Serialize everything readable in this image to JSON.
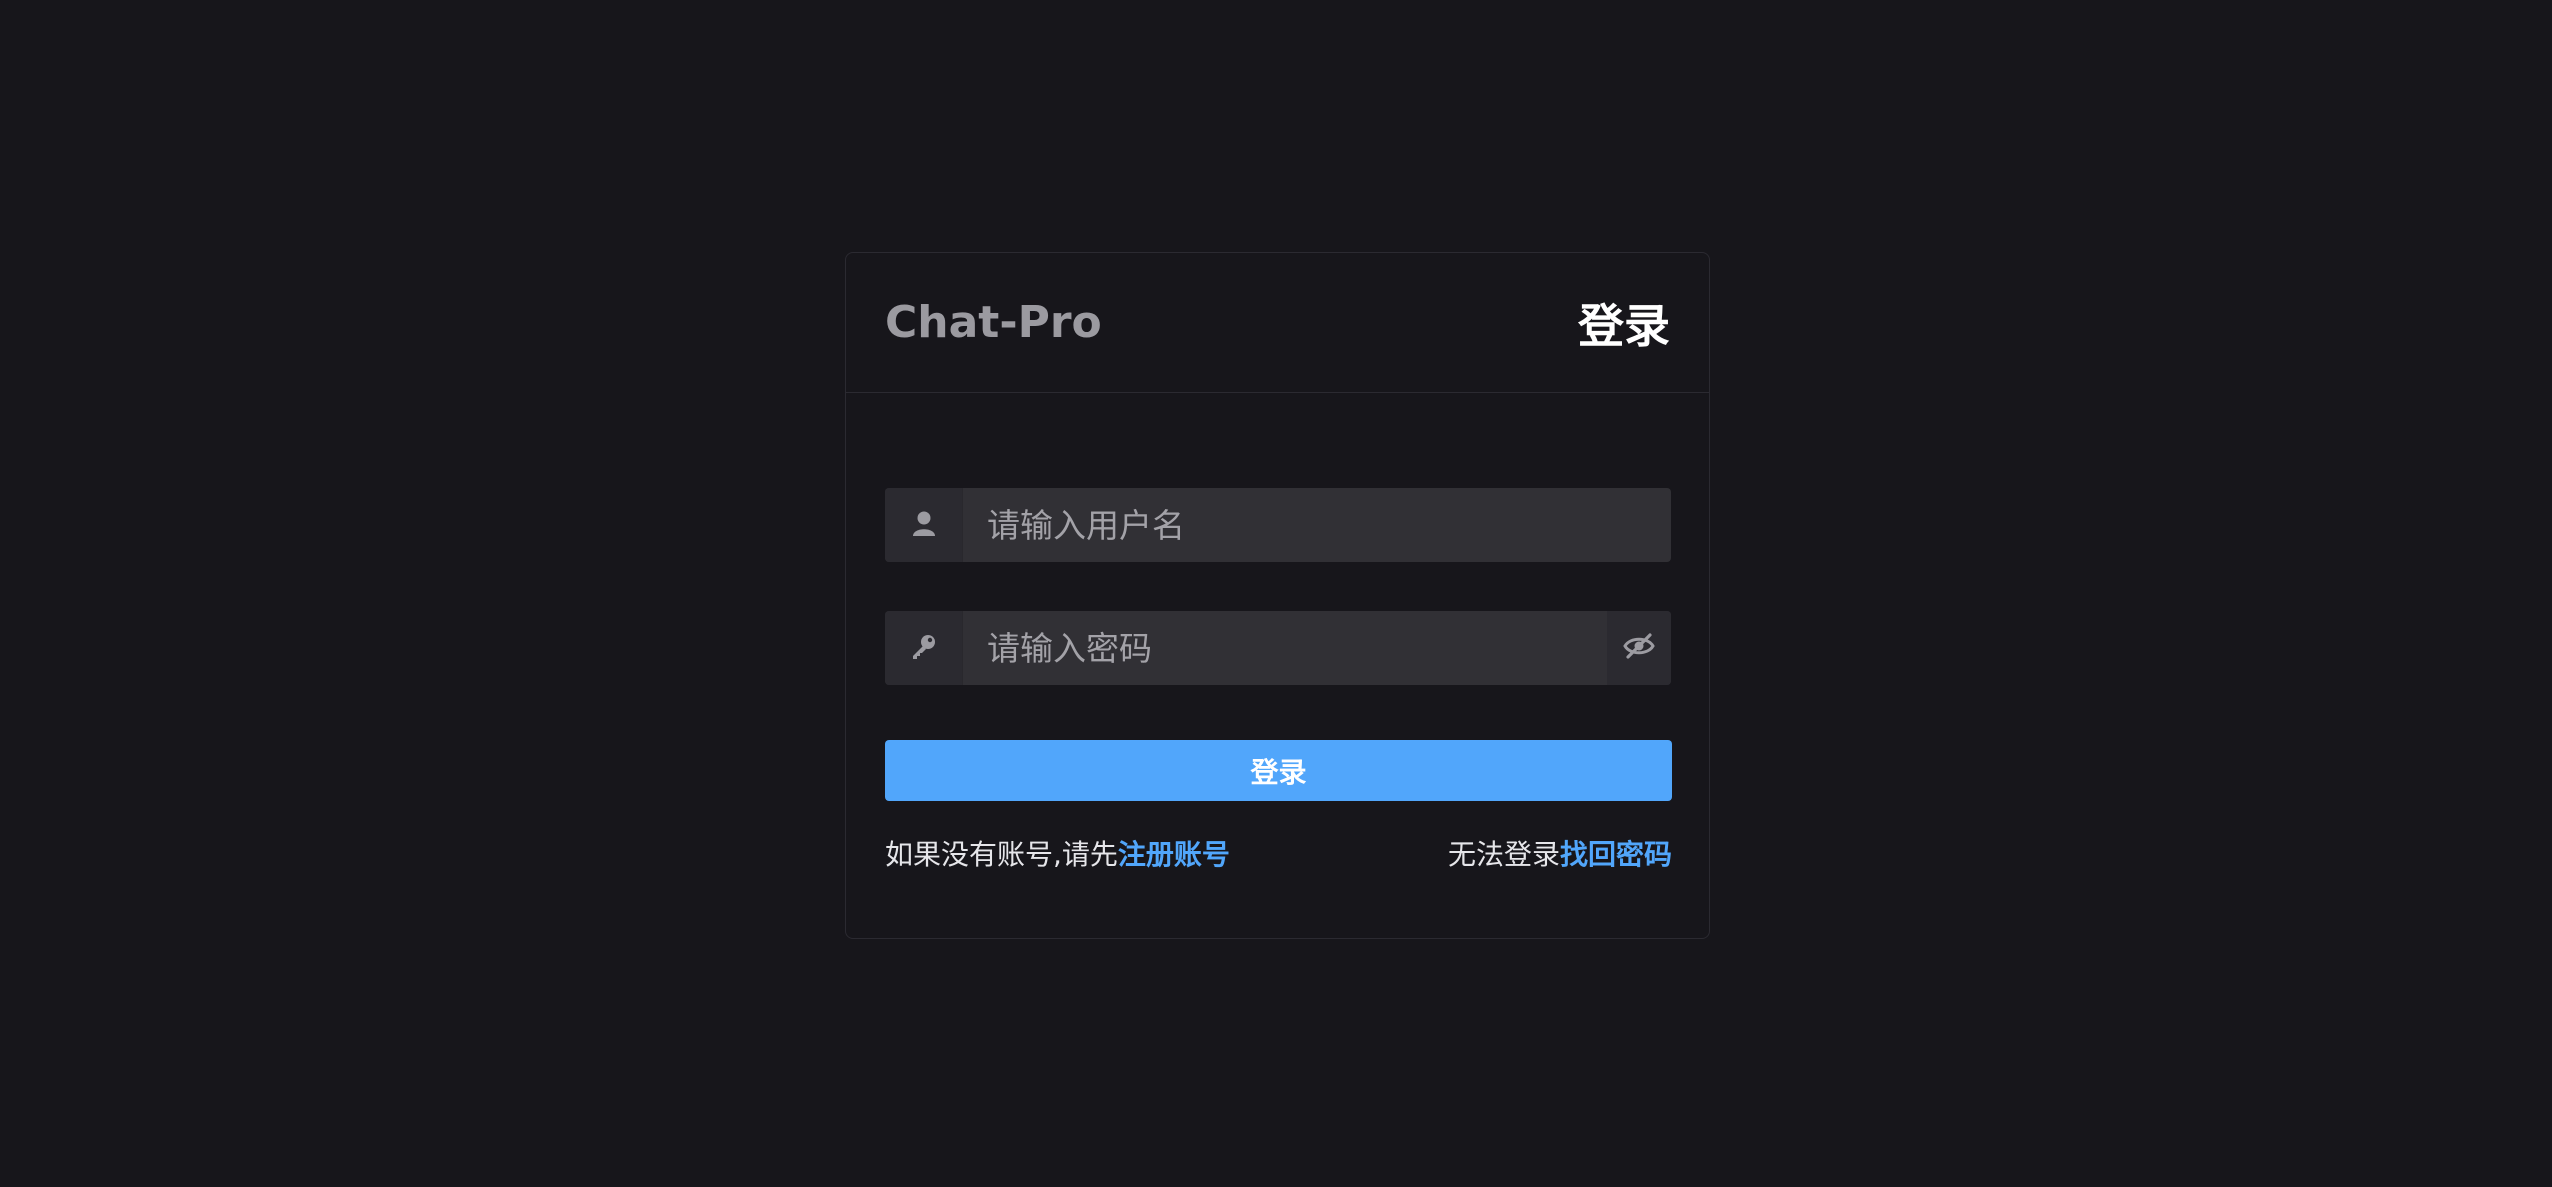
{
  "header": {
    "brand": "Chat-Pro",
    "title": "登录"
  },
  "form": {
    "username": {
      "placeholder": "请输入用户名",
      "value": "",
      "icon": "user-icon"
    },
    "password": {
      "placeholder": "请输入密码",
      "value": "",
      "icon": "key-icon",
      "toggle_icon": "eye-off-icon"
    },
    "submit_label": "登录"
  },
  "footer": {
    "register_prefix": "如果没有账号,请先",
    "register_link": "注册账号",
    "recover_prefix": "无法登录",
    "recover_link": "找回密码"
  },
  "colors": {
    "background": "#17161b",
    "accent": "#51a6fb",
    "input_bg": "#313035"
  }
}
